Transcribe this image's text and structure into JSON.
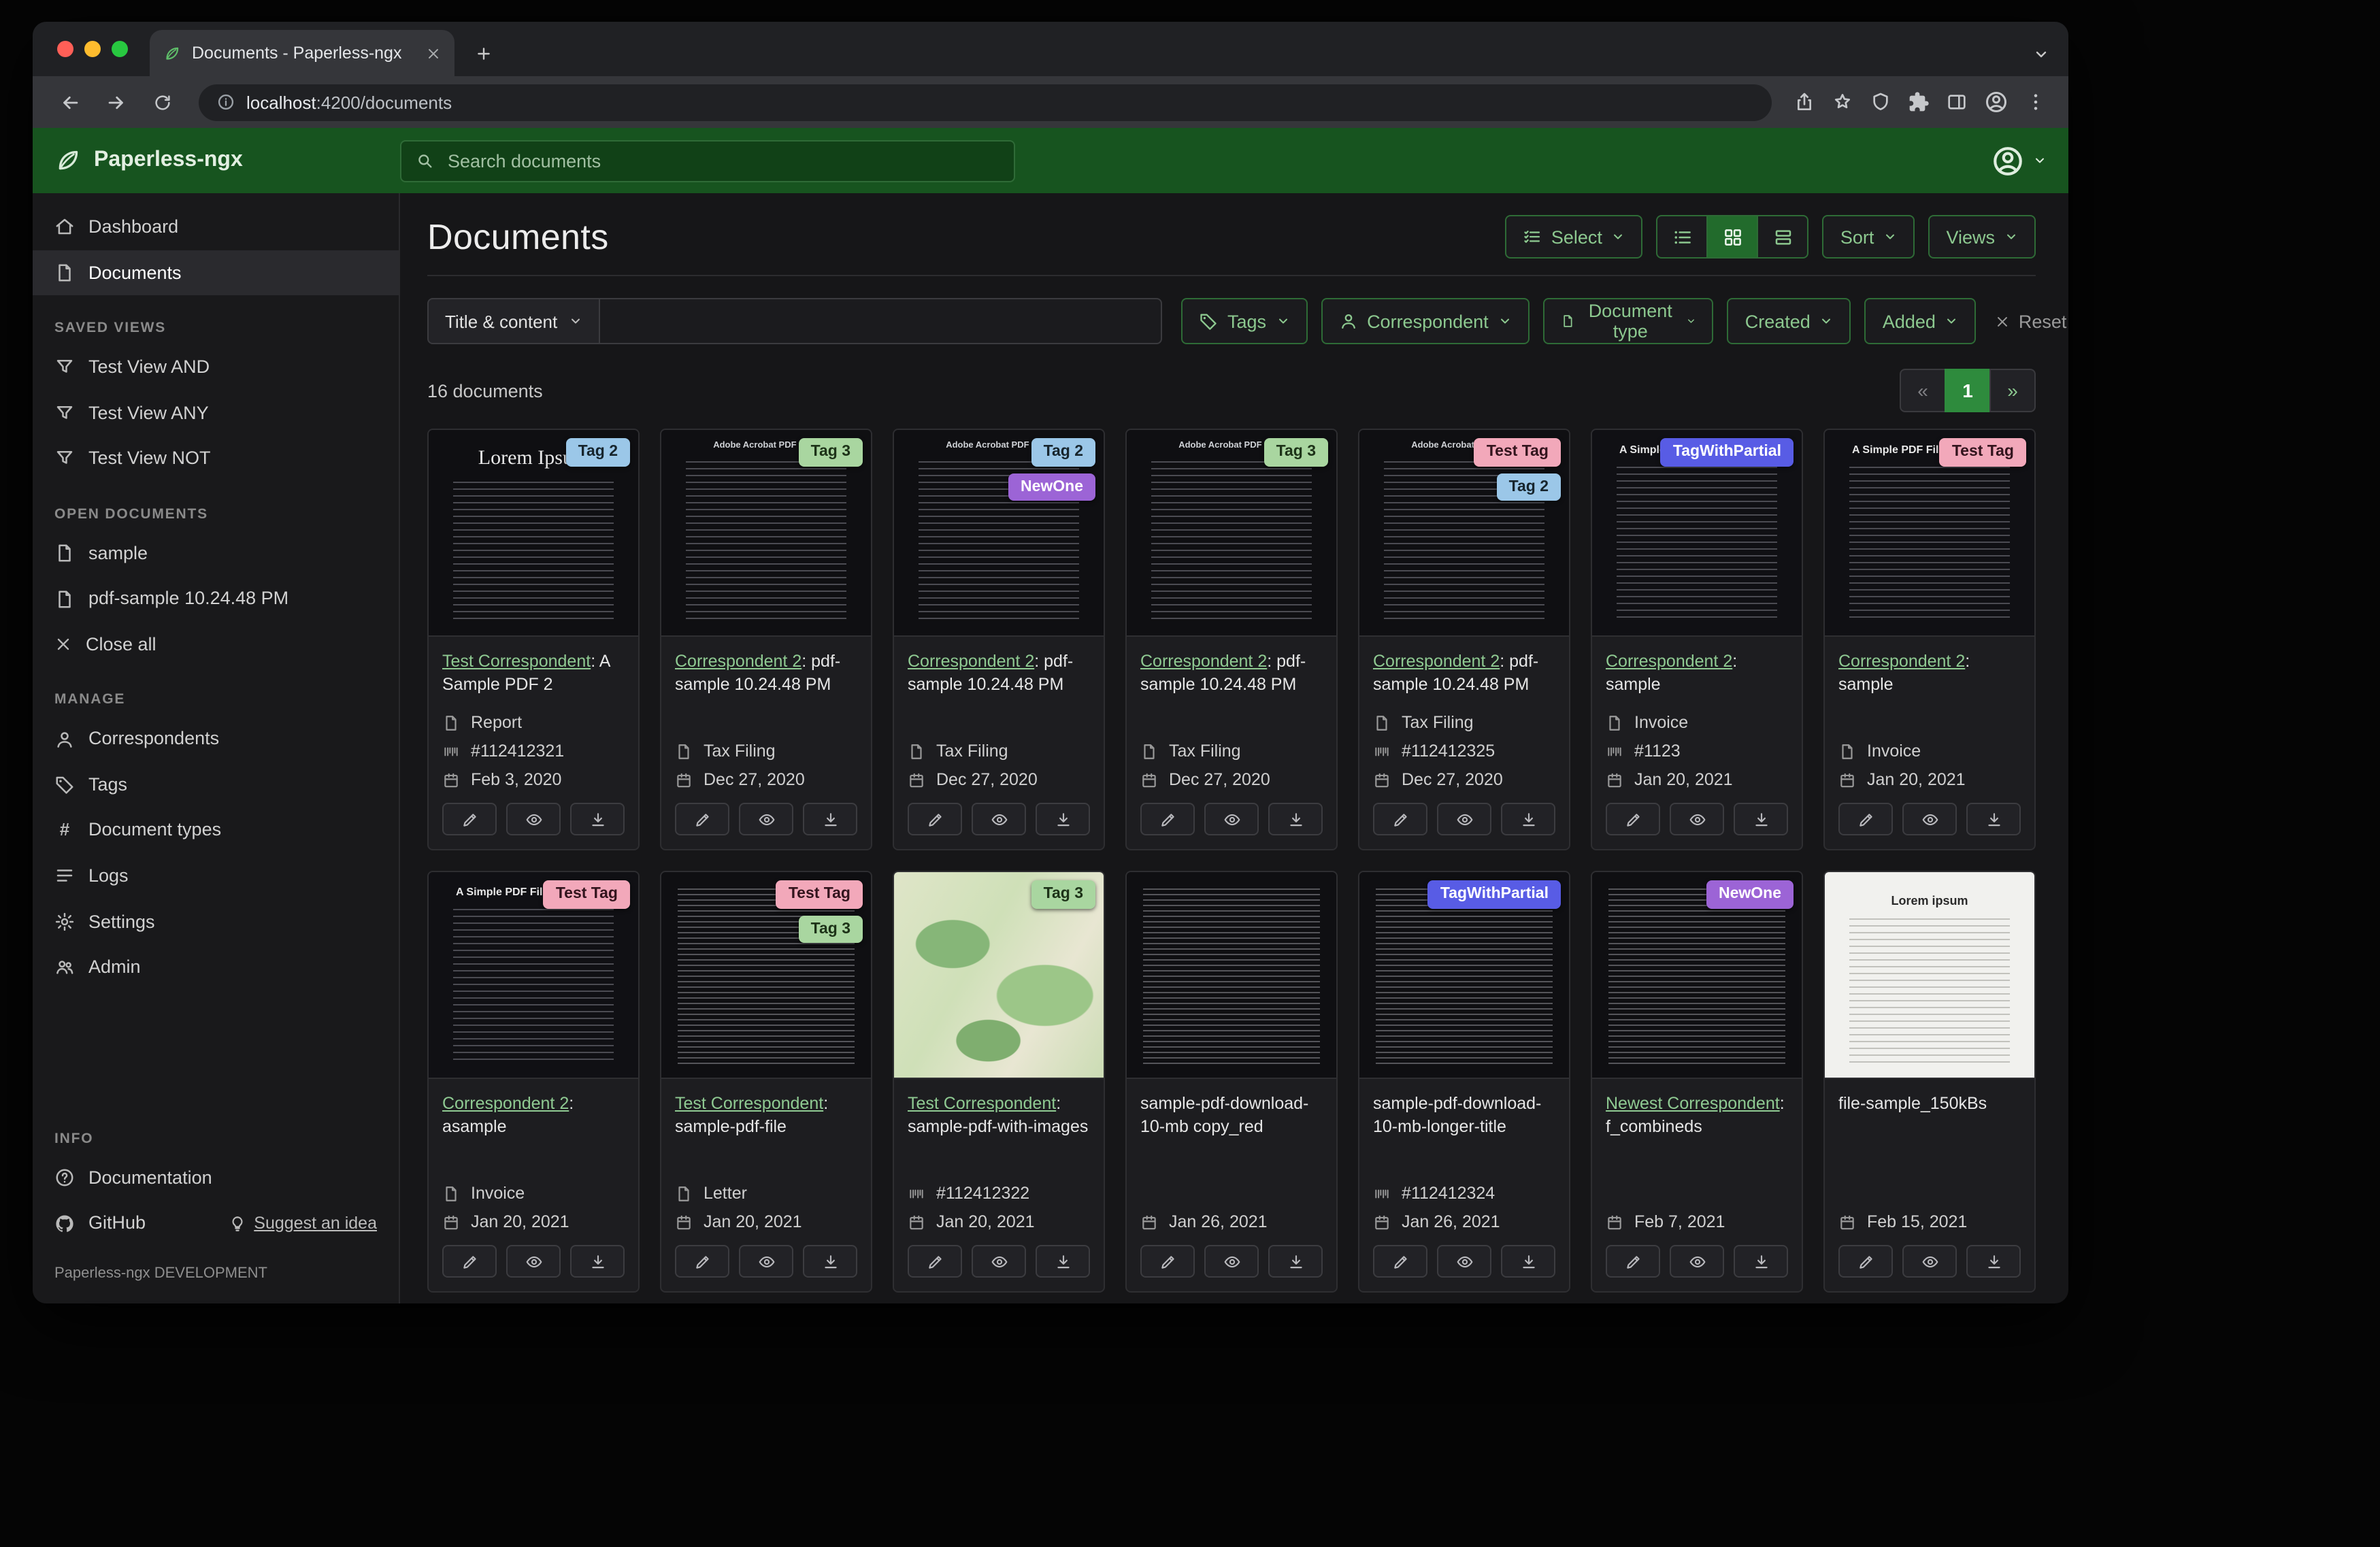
{
  "browser": {
    "tab_title": "Documents - Paperless-ngx",
    "url_host": "localhost",
    "url_rest": ":4200/documents"
  },
  "header": {
    "brand": "Paperless-ngx",
    "search_placeholder": "Search documents"
  },
  "sidebar": {
    "dashboard": "Dashboard",
    "documents": "Documents",
    "saved_views_header": "SAVED VIEWS",
    "saved_views": [
      "Test View AND",
      "Test View ANY",
      "Test View NOT"
    ],
    "open_documents_header": "OPEN DOCUMENTS",
    "open_documents": [
      "sample",
      "pdf-sample 10.24.48 PM"
    ],
    "close_all": "Close all",
    "manage_header": "MANAGE",
    "manage": [
      "Correspondents",
      "Tags",
      "Document types",
      "Logs",
      "Settings",
      "Admin"
    ],
    "info_header": "INFO",
    "documentation": "Documentation",
    "github": "GitHub",
    "suggest": "Suggest an idea",
    "footer": "Paperless-ngx DEVELOPMENT"
  },
  "main": {
    "title": "Documents",
    "select": "Select",
    "sort": "Sort",
    "views": "Views"
  },
  "filters": {
    "field": "Title & content",
    "tags": "Tags",
    "correspondent": "Correspondent",
    "document_type": "Document type",
    "created": "Created",
    "added": "Added",
    "reset": "Reset filters"
  },
  "results": {
    "count": "16 documents",
    "page_prev": "«",
    "page_current": "1",
    "page_next": "»"
  },
  "tag_colors": {
    "Tag 2": {
      "bg": "#9bc7e8",
      "fg": "#17252d"
    },
    "Tag 3": {
      "bg": "#a9d6a0",
      "fg": "#1d3318"
    },
    "NewOne": {
      "bg": "#9c64d6",
      "fg": "#ffffff"
    },
    "Test Tag": {
      "bg": "#f2a8ba",
      "fg": "#33141d"
    },
    "TagWithPartial": {
      "bg": "#585ce5",
      "fg": "#ffffff"
    }
  },
  "documents": [
    {
      "tags": [
        "Tag 2"
      ],
      "thumb": "lorem",
      "thumb_heading": "Lorem Ipsum",
      "correspondent": "Test Correspondent",
      "title": ": A Sample PDF 2",
      "type": "Report",
      "asn": "#112412321",
      "date": "Feb 3, 2020"
    },
    {
      "tags": [
        "Tag 3"
      ],
      "thumb": "acrobat",
      "thumb_heading": "Adobe Acrobat PDF Files",
      "correspondent": "Correspondent 2",
      "title": ": pdf-sample 10.24.48 PM",
      "type": "Tax Filing",
      "asn": null,
      "date": "Dec 27, 2020"
    },
    {
      "tags": [
        "Tag 2",
        "NewOne"
      ],
      "thumb": "acrobat",
      "thumb_heading": "Adobe Acrobat PDF Files",
      "correspondent": "Correspondent 2",
      "title": ": pdf-sample 10.24.48 PM",
      "type": "Tax Filing",
      "asn": null,
      "date": "Dec 27, 2020"
    },
    {
      "tags": [
        "Tag 3"
      ],
      "thumb": "acrobat",
      "thumb_heading": "Adobe Acrobat PDF Files",
      "correspondent": "Correspondent 2",
      "title": ": pdf-sample 10.24.48 PM",
      "type": "Tax Filing",
      "asn": null,
      "date": "Dec 27, 2020"
    },
    {
      "tags": [
        "Test Tag",
        "Tag 2"
      ],
      "thumb": "acrobat",
      "thumb_heading": "Adobe Acrobat PDF Files",
      "correspondent": "Correspondent 2",
      "title": ": pdf-sample 10.24.48 PM",
      "type": "Tax Filing",
      "asn": "#112412325",
      "date": "Dec 27, 2020"
    },
    {
      "tags": [
        "TagWithPartial"
      ],
      "thumb": "simple",
      "thumb_heading": "A Simple PDF File",
      "correspondent": "Correspondent 2",
      "title": ": sample",
      "type": "Invoice",
      "asn": "#1123",
      "date": "Jan 20, 2021"
    },
    {
      "tags": [
        "Test Tag"
      ],
      "thumb": "simple",
      "thumb_heading": "A Simple PDF File",
      "correspondent": "Correspondent 2",
      "title": ": sample",
      "type": "Invoice",
      "asn": null,
      "date": "Jan 20, 2021"
    },
    {
      "tags": [
        "Test Tag"
      ],
      "thumb": "simple",
      "thumb_heading": "A Simple PDF File",
      "correspondent": "Correspondent 2",
      "title": ": asample",
      "type": "Invoice",
      "asn": null,
      "date": "Jan 20, 2021"
    },
    {
      "tags": [
        "Test Tag",
        "Tag 3"
      ],
      "thumb": "dense",
      "thumb_heading": "",
      "correspondent": "Test Correspondent",
      "title": ": sample-pdf-file",
      "type": "Letter",
      "asn": null,
      "date": "Jan 20, 2021"
    },
    {
      "tags": [
        "Tag 3"
      ],
      "thumb": "map",
      "thumb_heading": "",
      "correspondent": "Test Correspondent",
      "title": ": sample-pdf-with-images",
      "type": null,
      "asn": "#112412322",
      "date": "Jan 20, 2021"
    },
    {
      "tags": [],
      "thumb": "dense",
      "thumb_heading": "",
      "correspondent": null,
      "title": "sample-pdf-download-10-mb copy_red",
      "type": null,
      "asn": null,
      "date": "Jan 26, 2021"
    },
    {
      "tags": [
        "TagWithPartial"
      ],
      "thumb": "dense",
      "thumb_heading": "",
      "correspondent": null,
      "title": "sample-pdf-download-10-mb-longer-title",
      "type": null,
      "asn": "#112412324",
      "date": "Jan 26, 2021"
    },
    {
      "tags": [
        "NewOne"
      ],
      "thumb": "dense",
      "thumb_heading": "",
      "correspondent": "Newest Correspondent",
      "title": ": f_combineds",
      "type": null,
      "asn": null,
      "date": "Feb 7, 2021"
    },
    {
      "tags": [],
      "thumb": "light",
      "thumb_heading": "Lorem ipsum",
      "correspondent": null,
      "title": "file-sample_150kBs",
      "type": null,
      "asn": null,
      "date": "Feb 15, 2021"
    }
  ]
}
